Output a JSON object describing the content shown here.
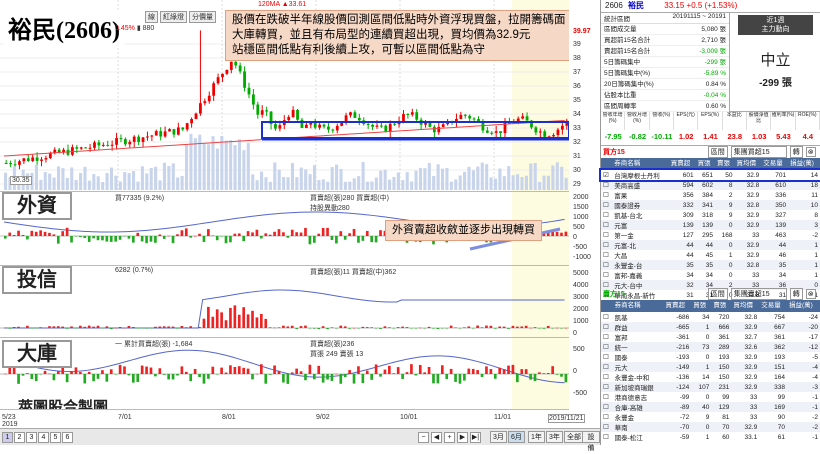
{
  "stock": {
    "title": "裕民(2606)",
    "code": "2606",
    "name": "裕民",
    "price": "33.15",
    "change": "+0.5 (+1.53%)",
    "ma120": "120MA ▲33.61"
  },
  "toolbar": {
    "tabs": [
      "線",
      "紅綠燈",
      "分價量"
    ],
    "pct": "0.45%",
    "vol": "880"
  },
  "annotations": {
    "main": [
      "股價在跌破半年線股價回測區間低點時外資浮現買盤，拉開籌碼面",
      "大庫轉買，並且有布局型的連續買超出現，買均價為32.9元",
      "站穩區間低點有利後續上攻，可暫以區間低點為守"
    ],
    "foreign": "外資賣超收斂並逐步出現轉買"
  },
  "price_axis": {
    "top_label": "39.97",
    "ticks": [
      "39",
      "38",
      "37",
      "36",
      "35",
      "34",
      "33",
      "32",
      "31",
      "30",
      "29"
    ],
    "bottom_label": "30.35"
  },
  "panels": {
    "foreign": {
      "label": "外資",
      "left_text": "買77335 (9.2%)",
      "legend": "買賣超(張)280 買賣超(中)",
      "sub": "持股異動280",
      "ticks": [
        "2000",
        "1500",
        "1000",
        "500",
        "0",
        "-500",
        "-1000"
      ]
    },
    "invest": {
      "label": "投信",
      "left_text": "6282 (0.7%)",
      "legend": "買賣超(張)11 買賣超(中)362",
      "ticks": [
        "5000",
        "4000",
        "3000",
        "2000",
        "1000",
        "0"
      ]
    },
    "dealer": {
      "label": "大庫",
      "left_text": "一 累計買賣超(張) -1,684",
      "legend": "買賣超(張)236",
      "sub": "買張 249 賣張 13",
      "ticks": [
        "500",
        "0",
        "-500"
      ]
    }
  },
  "footer": {
    "brand": "萊圖股合製圖",
    "dates": [
      "5/23",
      "2019",
      "7/01",
      "8/01",
      "9/02",
      "10/01",
      "11/01",
      "2019/11/21"
    ],
    "pages": [
      "1",
      "2",
      "3",
      "4",
      "5",
      "6"
    ],
    "timeframes": [
      "3月",
      "6月",
      "1年",
      "3年",
      "全部",
      "設備"
    ]
  },
  "right": {
    "stats_head": {
      "label": "統計區間",
      "range": "20191115 ~ 20191",
      "period": "近1週",
      "direction": "主力動向"
    },
    "stats": [
      {
        "k": "區間成交量",
        "v": "5,080 張"
      },
      {
        "k": "買超前15名合計",
        "v": "2,710 張"
      },
      {
        "k": "賣超前15名合計",
        "v": "-3,009 張"
      },
      {
        "k": "5日籌碼集中",
        "v": "-299 張"
      },
      {
        "k": "5日籌碼集中(%)",
        "v": "-5.89 %"
      },
      {
        "k": "20日籌碼集中(%)",
        "v": "0.84 %"
      },
      {
        "k": "佔股本比重",
        "v": "-0.04 %"
      },
      {
        "k": "區間周轉率",
        "v": "0.60 %"
      }
    ],
    "neutral": "中立",
    "neutral_val": "-299 張",
    "metrics": {
      "labels": [
        "營收年增(%)",
        "營收月增(%)",
        "營收(%)",
        "EPS(元)",
        "EPS(%)",
        "本益比",
        "股價淨值比",
        "殖利率(%)",
        "ROE(%)"
      ],
      "values": [
        "-7.95",
        "-0.82",
        "-10.11",
        "1.02",
        "1.41",
        "23.8",
        "1.03",
        "5.43",
        "4.4"
      ]
    },
    "buy_box": {
      "title": "買方15",
      "sub": "區間",
      "filter": "集團買超15",
      "btn1": "轉",
      "btn2": "⊗"
    },
    "cols": [
      "券商名稱",
      "買賣超",
      "買張",
      "賣張",
      "買均價",
      "交易量",
      "損益(萬)"
    ],
    "buy_rows": [
      [
        "台灣摩根士丹利",
        "601",
        "651",
        "50",
        "32.9",
        "701",
        "14"
      ],
      [
        "美商高盛",
        "594",
        "602",
        "8",
        "32.8",
        "610",
        "18"
      ],
      [
        "富果",
        "356",
        "384",
        "2",
        "32.9",
        "336",
        "11"
      ],
      [
        "國泰證券",
        "332",
        "341",
        "9",
        "32.8",
        "350",
        "10"
      ],
      [
        "凱基-台北",
        "309",
        "318",
        "9",
        "32.9",
        "327",
        "8"
      ],
      [
        "元富",
        "139",
        "139",
        "0",
        "32.9",
        "139",
        "3"
      ],
      [
        "第一金",
        "127",
        "295",
        "168",
        "33",
        "463",
        "-2"
      ],
      [
        "元富-北",
        "44",
        "44",
        "0",
        "32.9",
        "44",
        "1"
      ],
      [
        "大昌",
        "44",
        "45",
        "1",
        "32.9",
        "46",
        "1"
      ],
      [
        "永豐金-台",
        "35",
        "35",
        "0",
        "32.8",
        "35",
        "1"
      ],
      [
        "富邦-嘉義",
        "34",
        "34",
        "0",
        "33",
        "34",
        "1"
      ],
      [
        "元大-台中",
        "32",
        "34",
        "2",
        "33",
        "36",
        "0"
      ],
      [
        "華南永昌-新竹",
        "31",
        "31",
        "0",
        "32.8",
        "31",
        "1"
      ]
    ],
    "sell_box": {
      "title": "賣方15",
      "sub": "區間",
      "filter": "集團賣超15",
      "btn1": "轉",
      "btn2": "⊗"
    },
    "sell_rows": [
      [
        "凱基",
        "-686",
        "34",
        "720",
        "32.8",
        "754",
        "-24"
      ],
      [
        "群益",
        "-665",
        "1",
        "666",
        "32.9",
        "667",
        "-20"
      ],
      [
        "富邦",
        "-361",
        "0",
        "361",
        "32.7",
        "361",
        "-17"
      ],
      [
        "統一",
        "-216",
        "73",
        "289",
        "32.6",
        "362",
        "-12"
      ],
      [
        "國泰",
        "-193",
        "0",
        "193",
        "32.9",
        "193",
        "-5"
      ],
      [
        "元大",
        "-149",
        "1",
        "150",
        "32.9",
        "151",
        "-4"
      ],
      [
        "永豐金-中和",
        "-136",
        "14",
        "150",
        "32.9",
        "164",
        "-4"
      ],
      [
        "新加坡商瑞銀",
        "-124",
        "107",
        "231",
        "32.9",
        "338",
        "-3"
      ],
      [
        "港商德意志",
        "-99",
        "0",
        "99",
        "33",
        "99",
        "-1"
      ],
      [
        "合庫-高雄",
        "-89",
        "40",
        "129",
        "33",
        "169",
        "-1"
      ],
      [
        "永豐金",
        "-72",
        "9",
        "81",
        "33",
        "90",
        "-2"
      ],
      [
        "華南",
        "-70",
        "0",
        "70",
        "32.9",
        "70",
        "-2"
      ],
      [
        "國泰-松江",
        "-59",
        "1",
        "60",
        "33.1",
        "61",
        "-1"
      ]
    ]
  }
}
